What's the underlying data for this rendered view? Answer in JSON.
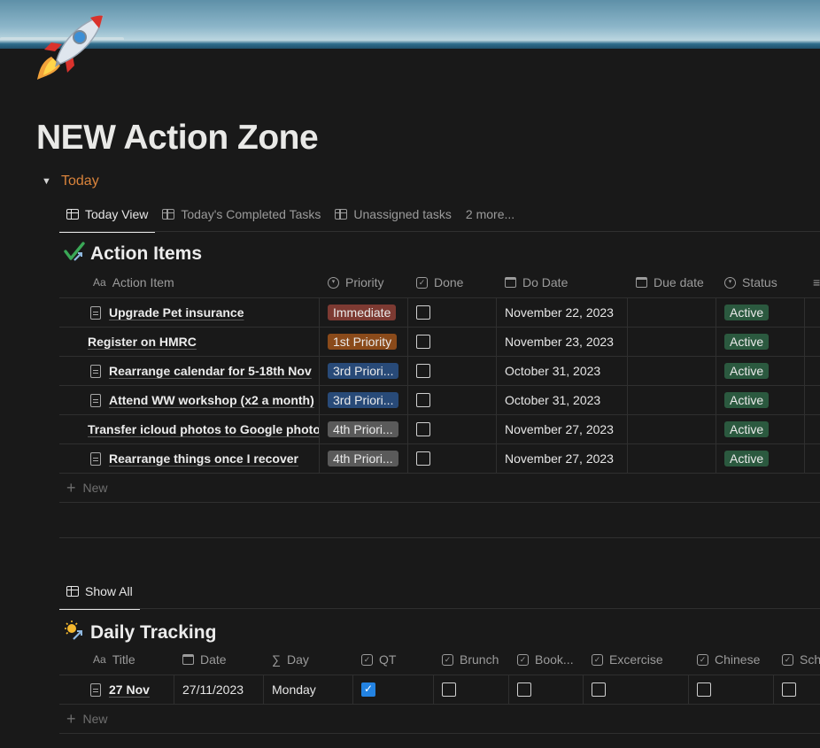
{
  "page": {
    "icon": "rocket-icon",
    "title": "NEW Action Zone"
  },
  "toggle": {
    "label": "Today"
  },
  "views_top": {
    "tabs": [
      "Today View",
      "Today's Completed Tasks",
      "Unassigned tasks"
    ],
    "more": "2 more..."
  },
  "action_items": {
    "title": "Action Items",
    "columns": {
      "name": "Action Item",
      "priority": "Priority",
      "done": "Done",
      "do_date": "Do Date",
      "due_date": "Due date",
      "status": "Status"
    },
    "rows": [
      {
        "name": "Upgrade Pet insurance",
        "has_doc": true,
        "priority": "Immediate",
        "priority_color": "#7d3a32",
        "done": false,
        "do_date": "November 22, 2023",
        "due_date": "",
        "status": "Active"
      },
      {
        "name": "Register on HMRC",
        "has_doc": false,
        "priority": "1st Priority",
        "priority_color": "#8a4a1a",
        "done": false,
        "do_date": "November 23, 2023",
        "due_date": "",
        "status": "Active"
      },
      {
        "name": "Rearrange calendar for 5-18th Nov",
        "has_doc": true,
        "priority": "3rd Priori...",
        "priority_color": "#284a78",
        "done": false,
        "do_date": "October 31, 2023",
        "due_date": "",
        "status": "Active"
      },
      {
        "name": "Attend WW workshop (x2 a month)",
        "has_doc": true,
        "priority": "3rd Priori...",
        "priority_color": "#284a78",
        "done": false,
        "do_date": "October 31, 2023",
        "due_date": "",
        "status": "Active"
      },
      {
        "name": "Transfer icloud photos to Google photos",
        "has_doc": false,
        "priority": "4th Priori...",
        "priority_color": "#5a5a5a",
        "done": false,
        "do_date": "November 27, 2023",
        "due_date": "",
        "status": "Active"
      },
      {
        "name": "Rearrange things once I recover",
        "has_doc": true,
        "priority": "4th Priori...",
        "priority_color": "#5a5a5a",
        "done": false,
        "do_date": "November 27, 2023",
        "due_date": "",
        "status": "Active"
      }
    ],
    "status_color": "#2b593f",
    "new_label": "New"
  },
  "views_bottom": {
    "tabs": [
      "Show All"
    ]
  },
  "daily_tracking": {
    "title": "Daily Tracking",
    "columns": {
      "title": "Title",
      "date": "Date",
      "day": "Day",
      "qt": "QT",
      "brunch": "Brunch",
      "book": "Book...",
      "exercise": "Excercise",
      "chinese": "Chinese",
      "sch": "Sch"
    },
    "rows": [
      {
        "title": "27 Nov",
        "date": "27/11/2023",
        "day": "Monday",
        "qt": true,
        "brunch": false,
        "book": false,
        "exercise": false,
        "chinese": false,
        "sch": false
      }
    ],
    "new_label": "New"
  }
}
